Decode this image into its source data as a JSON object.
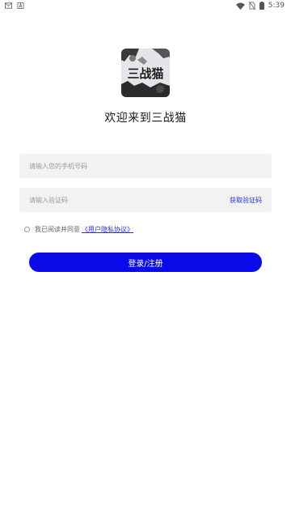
{
  "status_bar": {
    "left_icons": [
      "mail-icon",
      "a-icon"
    ],
    "right_icons": [
      "wifi-icon",
      "no-sim-icon",
      "battery-icon"
    ],
    "time": "5:39"
  },
  "app": {
    "logo_text": "三战猫",
    "welcome": "欢迎来到三战猫"
  },
  "form": {
    "phone_placeholder": "请输入您的手机号码",
    "code_placeholder": "请输入验证码",
    "get_code_label": "获取验证码",
    "agree_prefix": "我已阅读并同意",
    "agree_link": "《用户隐私协议》",
    "submit_label": "登录/注册"
  },
  "colors": {
    "primary": "#0a0ae8",
    "link": "#2a2fd9",
    "field_bg": "#f2f2f2"
  }
}
